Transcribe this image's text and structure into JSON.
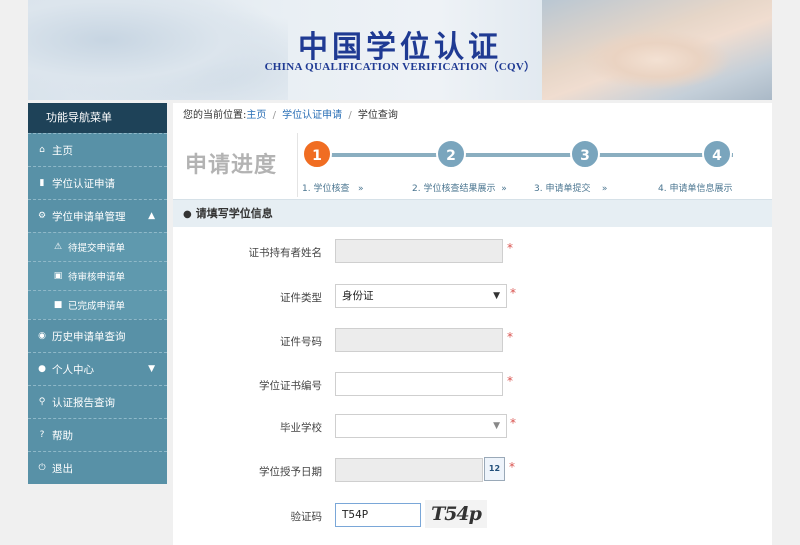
{
  "banner": {
    "title_cn": "中国学位认证",
    "title_en": "CHINA QUALIFICATION VERIFICATION（CQV）"
  },
  "sidebar": {
    "header": "功能导航菜单",
    "items": [
      {
        "label": "主页",
        "icon": "home-icon"
      },
      {
        "label": "学位认证申请",
        "icon": "document-icon"
      },
      {
        "label": "学位申请单管理",
        "icon": "gear-icon",
        "expanded": true
      },
      {
        "label": "待提交申请单",
        "icon": "warning-icon"
      },
      {
        "label": "待审核申请单",
        "icon": "cart-icon"
      },
      {
        "label": "已完成申请单",
        "icon": "briefcase-icon"
      },
      {
        "label": "历史申请单查询",
        "icon": "camera-icon"
      },
      {
        "label": "个人中心",
        "icon": "user-icon",
        "expanded": false
      },
      {
        "label": "认证报告查询",
        "icon": "search-icon"
      },
      {
        "label": "帮助",
        "icon": "help-icon"
      },
      {
        "label": "退出",
        "icon": "power-icon"
      }
    ]
  },
  "breadcrumb": {
    "prefix": "您的当前位置:",
    "home": "主页",
    "sep": "/",
    "apply": "学位认证申请",
    "current": "学位查询"
  },
  "progress": {
    "title": "申请进度",
    "current_step": 1,
    "steps": [
      {
        "num": "1",
        "label": "1. 学位核查"
      },
      {
        "num": "2",
        "label": "2. 学位核查结果展示"
      },
      {
        "num": "3",
        "label": "3. 申请单提交"
      },
      {
        "num": "4",
        "label": "4. 申请单信息展示"
      }
    ],
    "arrow": "»"
  },
  "section": {
    "title": "请填写学位信息"
  },
  "form": {
    "holder_name": {
      "label": "证书持有者姓名",
      "value": ""
    },
    "id_type": {
      "label": "证件类型",
      "value": "身份证"
    },
    "id_number": {
      "label": "证件号码",
      "value": ""
    },
    "cert_number": {
      "label": "学位证书编号",
      "value": ""
    },
    "school": {
      "label": "毕业学校",
      "value": ""
    },
    "grant_date": {
      "label": "学位授予日期",
      "value": ""
    },
    "captcha": {
      "label": "验证码",
      "value": "T54P",
      "image_text": "T54p"
    },
    "required_mark": "*",
    "calendar_day": "12"
  },
  "colors": {
    "sidebar_bg": "#5891a7",
    "sidebar_head": "#1e4258",
    "active_step": "#f06d22",
    "step": "#7aa5bd",
    "title_blue": "#1f3a93"
  }
}
